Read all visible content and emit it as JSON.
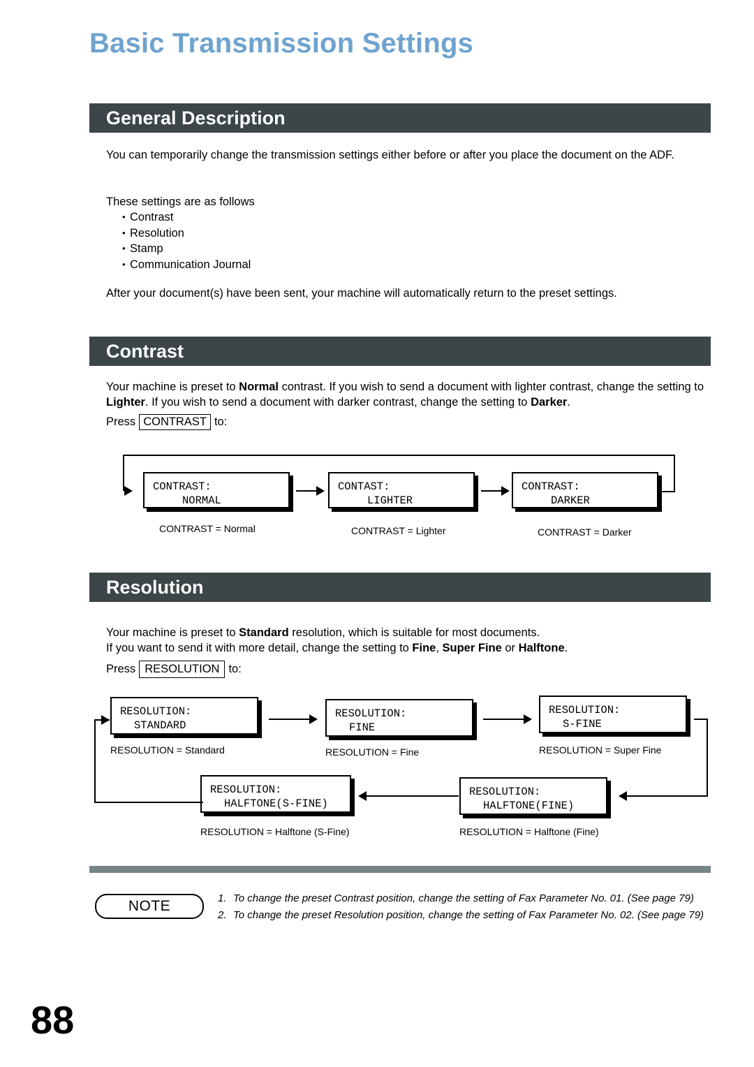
{
  "page": {
    "title": "Basic Transmission Settings",
    "number": "88",
    "title_color": "#6fa3cf",
    "bar_color": "#3c4548",
    "divider_color": "#768585"
  },
  "sections": {
    "general": {
      "heading": "General Description",
      "intro": "You can temporarily change the transmission settings either before or after you place the document on the ADF.",
      "follows_label": "These settings are as follows",
      "bullets": [
        "Contrast",
        "Resolution",
        "Stamp",
        "Communication Journal"
      ],
      "after": "After your document(s) have been sent, your machine will automatically return to the preset settings."
    },
    "contrast": {
      "heading": "Contrast",
      "paragraph_1a": "Your machine is preset to ",
      "paragraph_1b": "Normal",
      "paragraph_1c": " contrast.  If you wish to send a document with lighter contrast, change the setting to ",
      "paragraph_1d": "Lighter",
      "paragraph_1e": ".  If you wish to send a document with darker contrast, change the setting to ",
      "paragraph_1f": "Darker",
      "paragraph_1g": ".",
      "press_prefix": "Press",
      "press_key": "CONTRAST",
      "press_suffix": "to:",
      "steps": [
        {
          "line1": "CONTRAST:",
          "line2": "NORMAL",
          "caption": "CONTRAST = Normal"
        },
        {
          "line1": "CONTAST:",
          "line2": "LIGHTER",
          "caption": "CONTRAST = Lighter"
        },
        {
          "line1": "CONTRAST:",
          "line2": "DARKER",
          "caption": "CONTRAST = Darker"
        }
      ]
    },
    "resolution": {
      "heading": "Resolution",
      "paragraph_1a": "Your machine is preset to ",
      "paragraph_1b": "Standard",
      "paragraph_1c": " resolution, which is suitable for most documents.",
      "paragraph_2a": "If you want to send it with more detail, change the setting to ",
      "paragraph_2b": "Fine",
      "paragraph_2c": ", ",
      "paragraph_2d": "Super Fine",
      "paragraph_2e": " or ",
      "paragraph_2f": "Halftone",
      "paragraph_2g": ".",
      "press_prefix": "Press",
      "press_key": "RESOLUTION",
      "press_suffix": "to:",
      "steps": [
        {
          "line1": "RESOLUTION:",
          "line2": "STANDARD",
          "caption": "RESOLUTION = Standard"
        },
        {
          "line1": "RESOLUTION:",
          "line2": "FINE",
          "caption": "RESOLUTION = Fine"
        },
        {
          "line1": "RESOLUTION:",
          "line2": "S-FINE",
          "caption": "RESOLUTION = Super Fine"
        },
        {
          "line1": "RESOLUTION:",
          "line2": "HALFTONE(FINE)",
          "caption": "RESOLUTION = Halftone (Fine)"
        },
        {
          "line1": "RESOLUTION:",
          "line2": "HALFTONE(S-FINE)",
          "caption": "RESOLUTION = Halftone (S-Fine)"
        }
      ]
    }
  },
  "note": {
    "label": "NOTE",
    "items": [
      {
        "num": "1.",
        "text": "To change the preset Contrast position, change the setting of Fax Parameter No. 01. (See page 79)"
      },
      {
        "num": "2.",
        "text": "To change the preset Resolution position, change the setting of Fax Parameter No. 02.  (See page 79)"
      }
    ]
  }
}
